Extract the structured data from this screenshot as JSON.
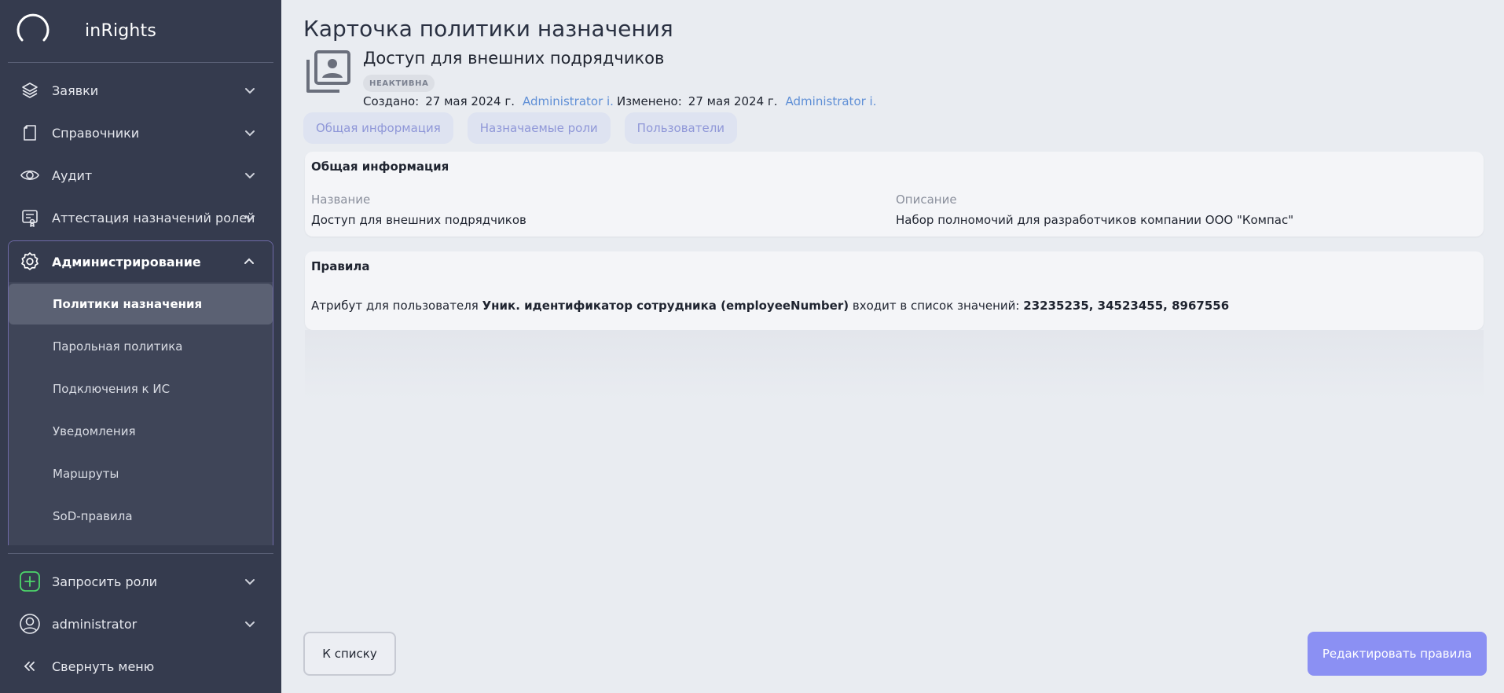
{
  "sidebar": {
    "brand": {
      "name": "inRights"
    },
    "items": [
      {
        "label": "Заявки",
        "icon": "layers-icon"
      },
      {
        "label": "Справочники",
        "icon": "book-icon"
      },
      {
        "label": "Аудит",
        "icon": "eye-icon"
      },
      {
        "label": "Аттестация назначений ролей",
        "icon": "certificate-icon"
      }
    ],
    "admin": {
      "label": "Администрирование",
      "icon": "gear-icon",
      "expanded": true,
      "sub_items": [
        {
          "label": "Политики назначения",
          "active": true
        },
        {
          "label": "Парольная политика",
          "active": false
        },
        {
          "label": "Подключения к ИС",
          "active": false
        },
        {
          "label": "Уведомления",
          "active": false
        },
        {
          "label": "Маршруты",
          "active": false
        },
        {
          "label": "SoD-правила",
          "active": false
        }
      ]
    },
    "bottom": [
      {
        "label": "Запросить роли",
        "icon": "plus-square-icon"
      },
      {
        "label": "administrator",
        "icon": "user-circle-icon"
      },
      {
        "label": "Свернуть меню",
        "icon": "double-chevron-left-icon"
      }
    ]
  },
  "page": {
    "title": "Карточка политики назначения",
    "policy_name": "Доступ для внешних подрядчиков",
    "status": "НЕАКТИВНА",
    "created_label": "Создано:",
    "created_date": "27 мая 2024 г.",
    "created_by": "Administrator i.",
    "modified_label": "Изменено:",
    "modified_date": "27 мая 2024 г.",
    "modified_by": "Administrator i."
  },
  "tabs": [
    {
      "label": "Общая информация"
    },
    {
      "label": "Назначаемые роли"
    },
    {
      "label": "Пользователи"
    }
  ],
  "general": {
    "title": "Общая информация",
    "name_label": "Название",
    "name_value": "Доступ для внешних подрядчиков",
    "desc_label": "Описание",
    "desc_value": "Набор полномочий для разработчиков компании ООО \"Компас\""
  },
  "rules": {
    "title": "Правила",
    "prefix": "Атрибут для пользователя",
    "attribute": "Уник. идентификатор сотрудника (employeeNumber)",
    "middle": "входит в список значений:",
    "values": "23235235, 34523455, 8967556"
  },
  "actions": {
    "back_label": "К списку",
    "edit_label": "Редактировать правила"
  },
  "colors": {
    "sidebar_bg": "#353b4e",
    "accent": "#8b90f3",
    "link": "#5f8fd6",
    "add_green": "#4cd66a"
  }
}
